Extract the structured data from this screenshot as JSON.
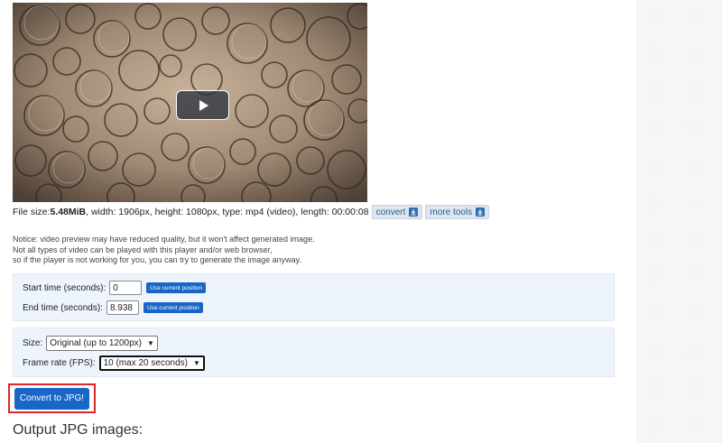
{
  "video": {
    "play_icon": "play-icon"
  },
  "file_info": {
    "prefix": "File size: ",
    "size": "5.48MiB",
    "details": ", width: 1906px, height: 1080px, type: mp4 (video), length: 00:00:08",
    "convert_label": "convert",
    "more_tools_label": "more tools",
    "download_icon": "download-icon"
  },
  "notice": {
    "line1": "Notice: video preview may have reduced quality, but it won't affect generated image.",
    "line2": "Not all types of video can be played with this player and/or web browser,",
    "line3": "so if the player is not working for you, you can try to generate the image anyway."
  },
  "time": {
    "start_label": "Start time (seconds):",
    "start_value": "0",
    "end_label": "End time (seconds):",
    "end_value": "8.938",
    "use_position_label": "Use current position"
  },
  "options": {
    "size_label": "Size:",
    "size_value": "Original (up to 1200px)",
    "fps_label": "Frame rate (FPS):",
    "fps_value": "10 (max 20 seconds)"
  },
  "convert_button": "Convert to JPG!",
  "output_title": "Output JPG images:",
  "colors": {
    "accent": "#1a66c8",
    "highlight": "#e0242a",
    "panel": "#eef4fb"
  }
}
